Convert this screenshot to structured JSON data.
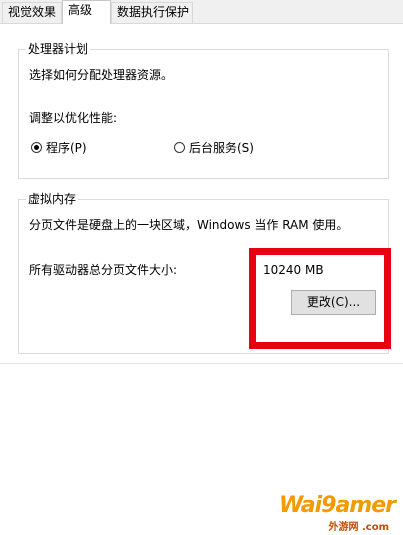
{
  "tabs": [
    {
      "label": "视觉效果",
      "active": false
    },
    {
      "label": "高级",
      "active": true
    },
    {
      "label": "数据执行保护",
      "active": false
    }
  ],
  "processor": {
    "title": "处理器计划",
    "desc": "选择如何分配处理器资源。",
    "adjust_label": "调整以优化性能:",
    "options": [
      {
        "label": "程序(P)",
        "checked": true
      },
      {
        "label": "后台服务(S)",
        "checked": false
      }
    ]
  },
  "virtual_memory": {
    "title": "虚拟内存",
    "desc": "分页文件是硬盘上的一块区域，Windows 当作 RAM 使用。",
    "total_label": "所有驱动器总分页文件大小:",
    "total_value": "10240 MB",
    "change_button": "更改(C)..."
  },
  "watermark": {
    "main": "Wai9amer",
    "sub": "外游网 .com"
  },
  "colors": {
    "highlight_box": "#e60012",
    "watermark": "#f29a00"
  }
}
